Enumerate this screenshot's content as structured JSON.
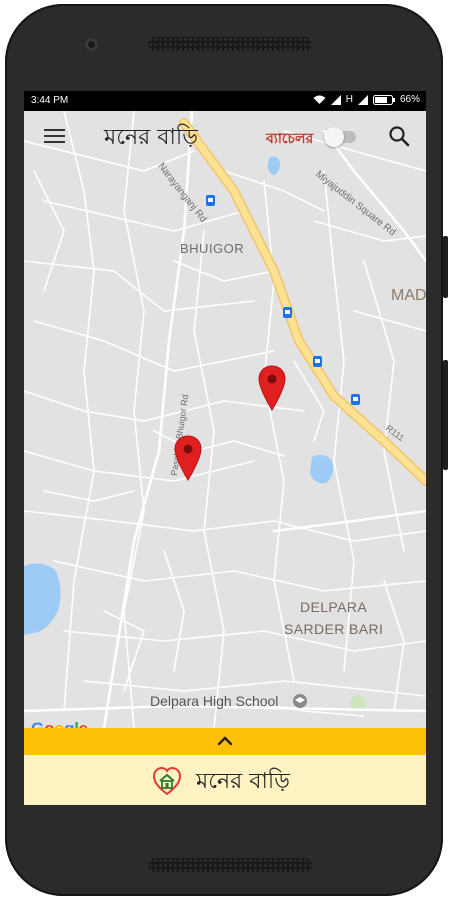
{
  "status_bar": {
    "time": "3:44 PM",
    "network": "H",
    "battery": "66%"
  },
  "toolbar": {
    "title": "মনের বাড়ি",
    "bachelor_label": "ব্যাচেলর",
    "bachelor_toggle_on": false
  },
  "map": {
    "labels": {
      "road_top": "Narayanganj Rd",
      "road_right": "Miyajuddin Square Rd",
      "area_bhuigor": "BHUIGOR",
      "area_mad": "MAD",
      "road_left": "Paschim Bhuigor Rd",
      "road_r111": "R111",
      "area_delpara_1": "DELPARA",
      "area_delpara_2": "SARDER BARI",
      "school": "Delpara High School"
    },
    "google_logo": "Google",
    "marker_count": 2
  },
  "bottom_sheet": {
    "expand_icon": "chevron-up-icon",
    "brand_name": "মনের বাড়ি"
  },
  "colors": {
    "accent_yellow": "#ffc107",
    "sheet_cream": "#fff3c4",
    "marker_red": "#e02020",
    "bachelor_red": "#c0392b",
    "highway_fill": "#fde293",
    "highway_stroke": "#f1c46a",
    "water": "#9ecbf5"
  }
}
